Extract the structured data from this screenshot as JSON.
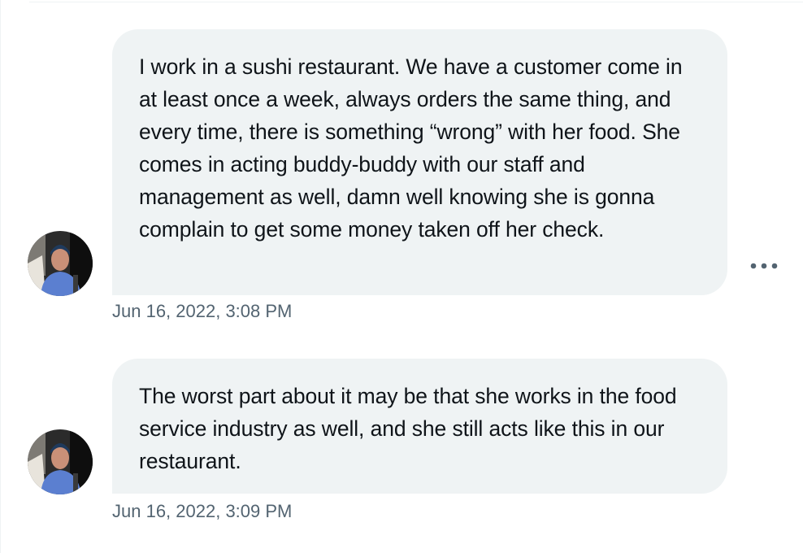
{
  "messages": [
    {
      "text": "I work in a sushi restaurant. We have a customer come in at least once a week, always orders the same thing, and every time, there is something “wrong” with her food. She comes in acting buddy-buddy with our staff and management as well, damn well knowing she is gonna complain to get some money taken off her check.",
      "timestamp": "Jun 16, 2022, 3:08 PM"
    },
    {
      "text": "The worst part about it may be that she works in the food service industry as well, and she still acts like this in our restaurant.",
      "timestamp": "Jun 16, 2022, 3:09 PM"
    }
  ],
  "icons": {
    "more": "more-horizontal-icon",
    "avatar": "user-avatar"
  },
  "colors": {
    "bubble_background": "#eff3f4",
    "text": "#0f1419",
    "timestamp": "#536471",
    "more_icon": "#536471"
  }
}
